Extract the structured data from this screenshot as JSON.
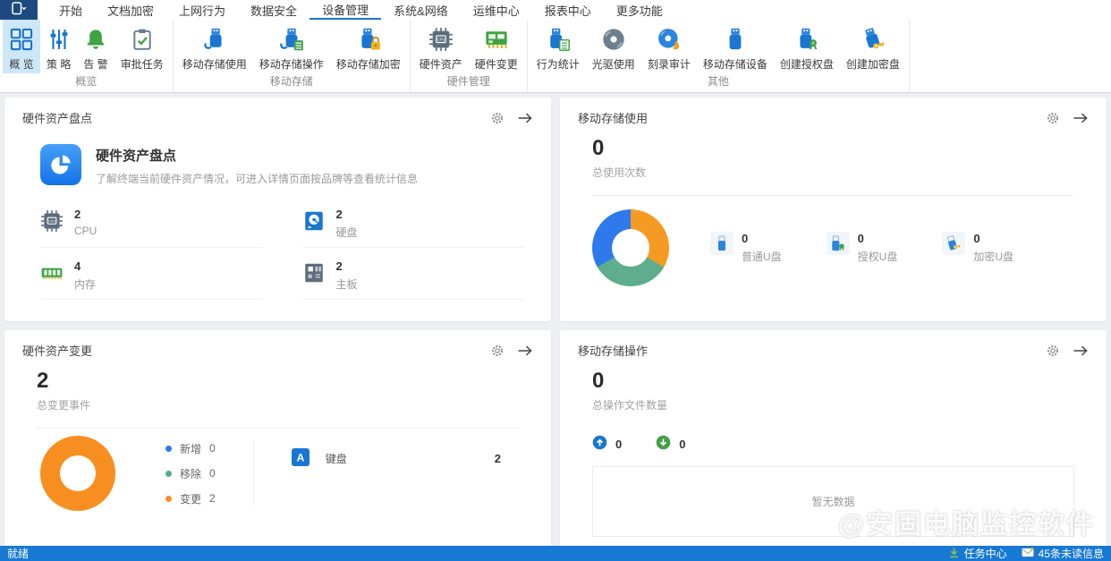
{
  "menu": {
    "items": [
      {
        "label": "开始"
      },
      {
        "label": "文档加密"
      },
      {
        "label": "上网行为"
      },
      {
        "label": "数据安全"
      },
      {
        "label": "设备管理"
      },
      {
        "label": "系统&网络"
      },
      {
        "label": "运维中心"
      },
      {
        "label": "报表中心"
      },
      {
        "label": "更多功能"
      }
    ],
    "active_item": "设备管理"
  },
  "ribbon": {
    "groups": [
      {
        "label": "概览",
        "items": [
          {
            "label": "概 览",
            "icon": "overview-grid-icon",
            "selected": true
          },
          {
            "label": "策 略",
            "icon": "policy-sliders-icon"
          },
          {
            "label": "告 警",
            "icon": "alarm-bell-icon"
          },
          {
            "label": "审批任务",
            "icon": "approval-clipboard-icon"
          }
        ]
      },
      {
        "label": "移动存储",
        "items": [
          {
            "label": "移动存储使用",
            "icon": "usb-usage-icon"
          },
          {
            "label": "移动存储操作",
            "icon": "usb-operation-icon"
          },
          {
            "label": "移动存储加密",
            "icon": "usb-encrypt-icon"
          }
        ]
      },
      {
        "label": "硬件管理",
        "items": [
          {
            "label": "硬件资产",
            "icon": "cpu-chip-icon"
          },
          {
            "label": "硬件变更",
            "icon": "hardware-change-icon"
          }
        ]
      },
      {
        "label": "其他",
        "items": [
          {
            "label": "行为统计",
            "icon": "behavior-stats-icon"
          },
          {
            "label": "光驱使用",
            "icon": "cdrom-icon"
          },
          {
            "label": "刻录审计",
            "icon": "burn-audit-icon"
          },
          {
            "label": "移动存储设备",
            "icon": "usb-device-icon"
          },
          {
            "label": "创建授权盘",
            "icon": "create-auth-disk-icon"
          },
          {
            "label": "创建加密盘",
            "icon": "create-encrypt-disk-icon"
          }
        ]
      }
    ]
  },
  "cards": {
    "hardware_inventory": {
      "title": "硬件资产盘点",
      "hero_title": "硬件资产盘点",
      "hero_desc": "了解终端当前硬件资产情况，可进入详情页面按品牌等查看统计信息",
      "stats": [
        {
          "label": "CPU",
          "value": "2",
          "icon": "cpu-chip-icon"
        },
        {
          "label": "硬盘",
          "value": "2",
          "icon": "harddisk-icon"
        },
        {
          "label": "内存",
          "value": "4",
          "icon": "memory-icon"
        },
        {
          "label": "主板",
          "value": "2",
          "icon": "motherboard-icon"
        }
      ]
    },
    "storage_usage": {
      "title": "移动存储使用",
      "total_value": "0",
      "total_label": "总使用次数",
      "donut_segments": [
        {
          "label": "普通U盘",
          "color": "#f59b23",
          "sweep_deg": 120
        },
        {
          "label": "授权U盘",
          "color": "#5eae8d",
          "sweep_deg": 120
        },
        {
          "label": "加密U盘",
          "color": "#2e79ec",
          "sweep_deg": 120
        }
      ],
      "stats": [
        {
          "label": "普通U盘",
          "value": "0",
          "icon": "usb-plain-icon"
        },
        {
          "label": "授权U盘",
          "value": "0",
          "icon": "usb-authorized-icon"
        },
        {
          "label": "加密U盘",
          "value": "0",
          "icon": "usb-encrypted-icon"
        }
      ]
    },
    "hardware_change": {
      "title": "硬件资产变更",
      "total_value": "2",
      "total_label": "总变更事件",
      "donut_color": "#f78f20",
      "legend": [
        {
          "label": "新增",
          "value": "0",
          "color": "#2e79ec"
        },
        {
          "label": "移除",
          "value": "0",
          "color": "#4caf85"
        },
        {
          "label": "变更",
          "value": "2",
          "color": "#f78f20"
        }
      ],
      "items": [
        {
          "label": "键盘",
          "value": "2",
          "icon": "keyboard-icon"
        }
      ]
    },
    "storage_operation": {
      "title": "移动存储操作",
      "total_value": "0",
      "total_label": "总操作文件数量",
      "upload_value": "0",
      "download_value": "0",
      "empty_text": "暂无数据"
    }
  },
  "statusbar": {
    "ready": "就绪",
    "task_center": "任务中心",
    "unread": "45条未读信息",
    "bg_color": "#1779d3"
  },
  "watermark": {
    "text": "@安固电脑监控软件"
  },
  "colors": {
    "accent_blue": "#1976d2",
    "ribbon_selected_bg": "#cde7f8",
    "page_bg": "#edeff2",
    "app_button_bg": "#1c4a80"
  }
}
